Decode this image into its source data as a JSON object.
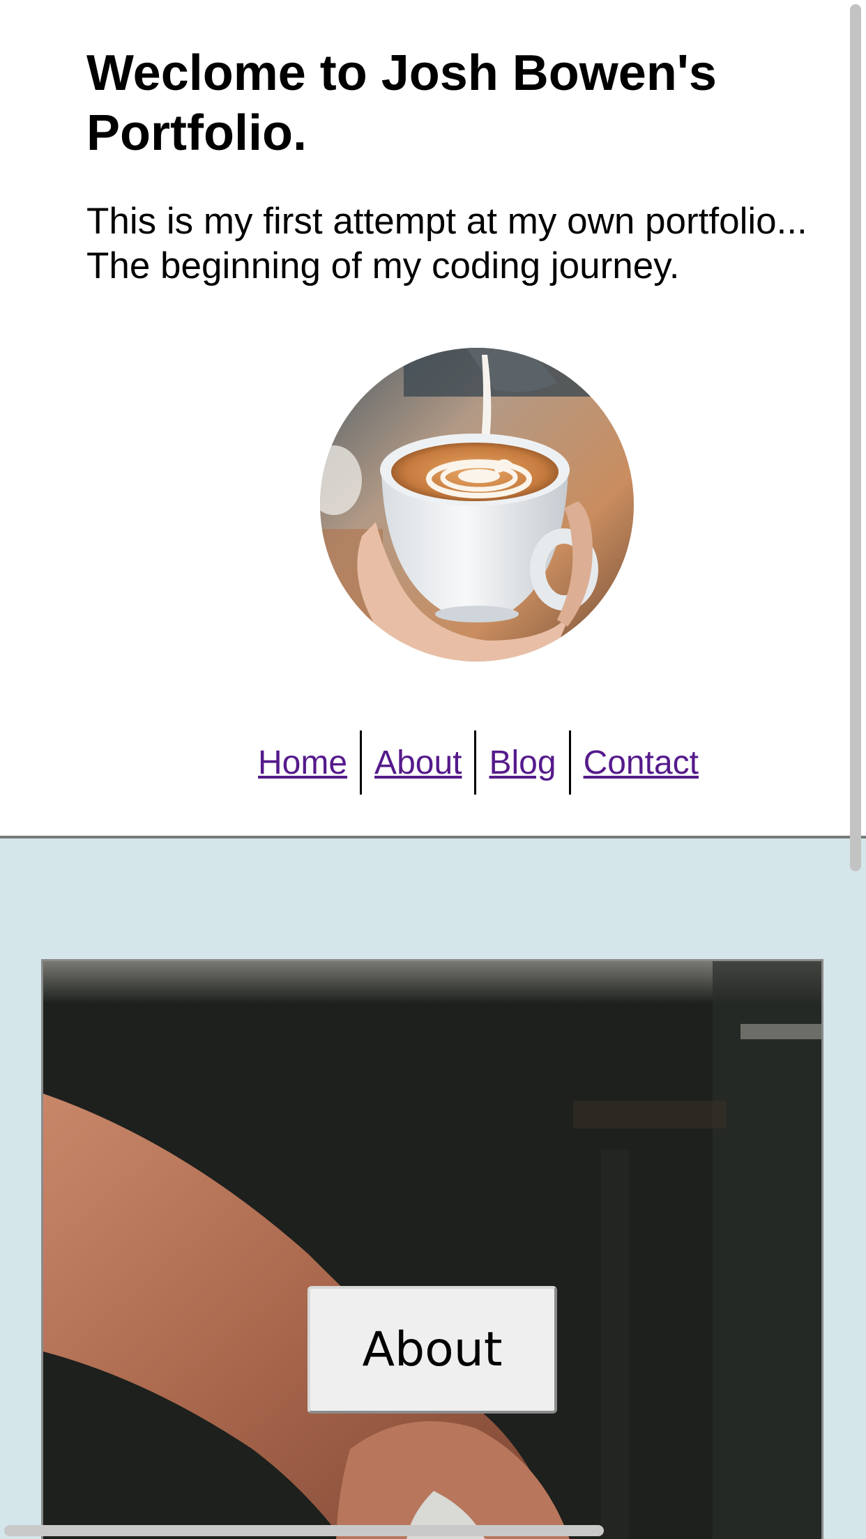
{
  "header": {
    "title": "Weclome to Josh Bowen's Portfolio.",
    "intro_line1": "This is my first attempt at my own portfolio...",
    "intro_line2": "The beginning of my coding journey."
  },
  "avatar": {
    "icon": "latte-art-photo"
  },
  "nav": {
    "home": "Home",
    "about": "About",
    "blog": "Blog",
    "contact": "Contact",
    "link_color": "#551a8b"
  },
  "hero": {
    "image": "arm-holding-cup-photo",
    "button_label": "About",
    "background_color": "#d4e6ea"
  }
}
